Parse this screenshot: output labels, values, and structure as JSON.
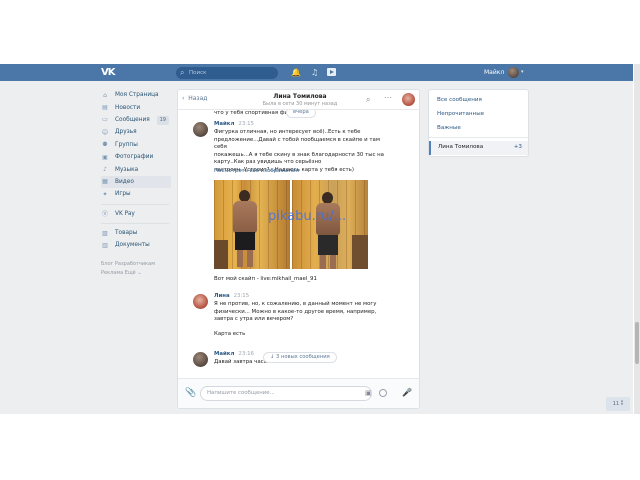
{
  "header": {
    "logo": "VK",
    "search_placeholder": "Поиск",
    "user_name": "Майкл"
  },
  "nav": {
    "items": [
      {
        "label": "Моя Страница",
        "icon": "home-icon"
      },
      {
        "label": "Новости",
        "icon": "news-icon"
      },
      {
        "label": "Сообщения",
        "icon": "messages-icon",
        "badge": "19"
      },
      {
        "label": "Друзья",
        "icon": "friends-icon"
      },
      {
        "label": "Группы",
        "icon": "groups-icon"
      },
      {
        "label": "Фотографии",
        "icon": "photos-icon"
      },
      {
        "label": "Музыка",
        "icon": "music-icon"
      },
      {
        "label": "Видео",
        "icon": "video-icon"
      },
      {
        "label": "Игры",
        "icon": "games-icon"
      }
    ],
    "vkpay": "VK Pay",
    "items2": [
      {
        "label": "Товары",
        "icon": "goods-icon"
      },
      {
        "label": "Документы",
        "icon": "documents-icon"
      }
    ],
    "footer_line1": "Блог   Разработчикам",
    "footer_line2": "Реклама   Ещё ⌄"
  },
  "chat": {
    "back": "Назад",
    "title": "Лина Томилова",
    "status": "Была в сети 30 минут назад",
    "old_text": "что у тебя спортивная фиг",
    "date_pill": "вчера",
    "messages": [
      {
        "name": "Майкл",
        "time": "23:15",
        "text": "Фигурка отличная, но интересует всё)..Есть к тебе\nпредложение...Давай с тобой пообщаемся в скайпе и там себя\nпокажешь...А я тебе скину в знак благодарности 30 тыс на\nкарту..Как раз увидишь что серьёзно\nнастроен..Устроит?...Надеюсь карта у тебя есть)",
        "link": "Посмотреть все изображения",
        "caption": "Вот мой скайп - live:mikhail_mael_91"
      },
      {
        "name": "Лина",
        "time": "23:15",
        "text": "Я не против, но, к сожалению, в данный момент не могу\nфизически... Можно в какое-то другое время, например,\nзавтра с утра или вечером?\n\nКарта есть"
      },
      {
        "name": "Майкл",
        "time": "23:16",
        "text": "Давай завтра часа"
      }
    ],
    "new_messages_pill": "3 новых сообщения",
    "input_placeholder": "Напишите сообщение...",
    "watermark": "pikabu.ru/..."
  },
  "right": {
    "items": [
      "Все сообщения",
      "Непрочитанные",
      "Важные"
    ],
    "conversation": {
      "name": "Лина Томилова",
      "count": "+3"
    }
  },
  "footer_counter": "11 ⁑"
}
